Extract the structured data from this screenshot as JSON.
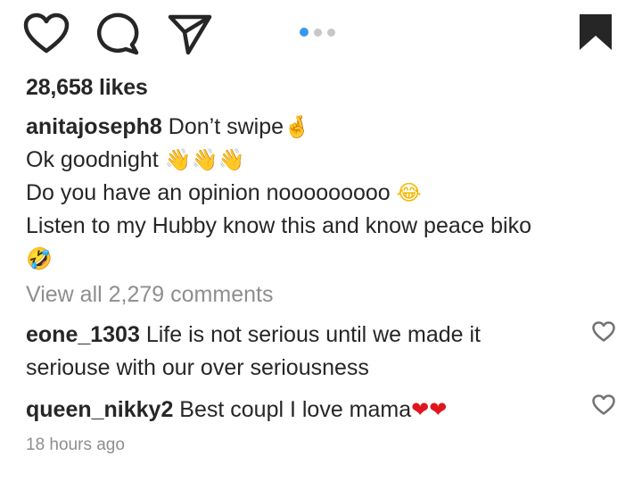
{
  "actions": {
    "like_icon": "heart-outline-icon",
    "comment_icon": "comment-bubble-icon",
    "share_icon": "paper-plane-icon",
    "save_icon": "bookmark-filled-icon"
  },
  "carousel": {
    "total": 3,
    "active_index": 0,
    "active_color": "#3897f0"
  },
  "post": {
    "likes": "28,658 likes",
    "caption": {
      "username": "anitajoseph8",
      "line1": " Don’t swipe",
      "line1_emoji": "🤞",
      "line2": "Ok goodnight ",
      "line2_emoji": "👋👋👋",
      "line3": "Do you have an opinion nooooooooo ",
      "line3_emoji": "😂",
      "line4": "Listen to my Hubby know this and know peace biko",
      "line5_emoji": "🤣"
    },
    "view_all_comments": "View all 2,279 comments",
    "comments": [
      {
        "username": "eone_1303",
        "text": " Life is not serious until we made it seriouse with our over seriousness",
        "emoji": ""
      },
      {
        "username": "queen_nikky2",
        "text": " Best coupl I love mama",
        "emoji": "❤❤"
      }
    ],
    "timestamp": "18 hours ago"
  }
}
